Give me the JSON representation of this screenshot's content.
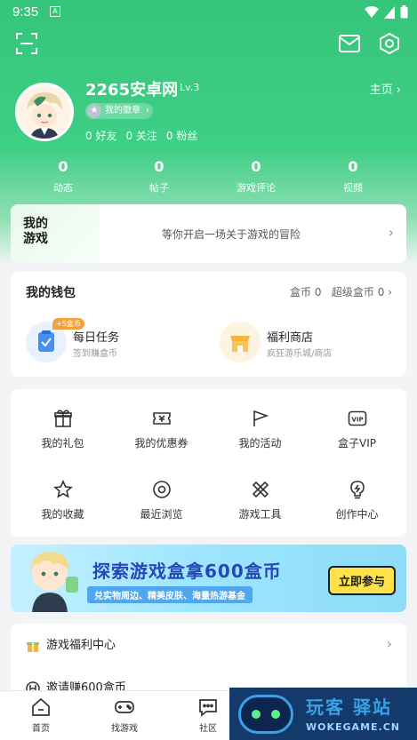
{
  "status_bar": {
    "time": "9:35",
    "sim_label": "A"
  },
  "profile": {
    "username": "2265安卓网",
    "level": "Lv.3",
    "badge_label": "我的徽章",
    "friends": "0 好友",
    "following": "0 关注",
    "fans": "0 粉丝",
    "homepage_link": "主页"
  },
  "stats": [
    {
      "value": "0",
      "label": "动态"
    },
    {
      "value": "0",
      "label": "帖子"
    },
    {
      "value": "0",
      "label": "游戏评论"
    },
    {
      "value": "0",
      "label": "视频"
    }
  ],
  "my_games": {
    "logo_text": "我的游戏",
    "message": "等你开启一场关于游戏的冒险"
  },
  "wallet": {
    "title": "我的钱包",
    "coins": "盒币 0",
    "super_coins": "超级盒币 0",
    "items": [
      {
        "name": "每日任务",
        "sub": "签到赚盒币",
        "tag": "+5盒币"
      },
      {
        "name": "福利商店",
        "sub": "疯狂游乐城/商店"
      }
    ]
  },
  "grid": [
    {
      "label": "我的礼包",
      "icon": "gift-icon"
    },
    {
      "label": "我的优惠券",
      "icon": "coupon-icon"
    },
    {
      "label": "我的活动",
      "icon": "flag-icon"
    },
    {
      "label": "盒子VIP",
      "icon": "vip-icon"
    },
    {
      "label": "我的收藏",
      "icon": "star-icon"
    },
    {
      "label": "最近浏览",
      "icon": "eye-icon"
    },
    {
      "label": "游戏工具",
      "icon": "tools-icon"
    },
    {
      "label": "创作中心",
      "icon": "bulb-icon"
    }
  ],
  "banner": {
    "headline": "探索游戏盒拿600盒币",
    "subline": "兑实物周边、精美皮肤、海量热游基金",
    "cta": "立即参与"
  },
  "links": [
    {
      "label": "游戏福利中心",
      "icon": "gift-center-icon"
    },
    {
      "label": "邀请赚600盒币",
      "icon": "invite-icon"
    }
  ],
  "tabbar": [
    {
      "label": "首页",
      "icon": "home-icon"
    },
    {
      "label": "找游戏",
      "icon": "gamepad-icon"
    },
    {
      "label": "社区",
      "icon": "chat-icon"
    }
  ],
  "watermark": {
    "line1": "玩客 驿站",
    "line2": "WOKEGAME.CN"
  },
  "colors": {
    "brand_green": "#3fce85",
    "accent_orange": "#f5a23a",
    "banner_blue": "#2747b8",
    "cta_yellow": "#ffe14a"
  }
}
